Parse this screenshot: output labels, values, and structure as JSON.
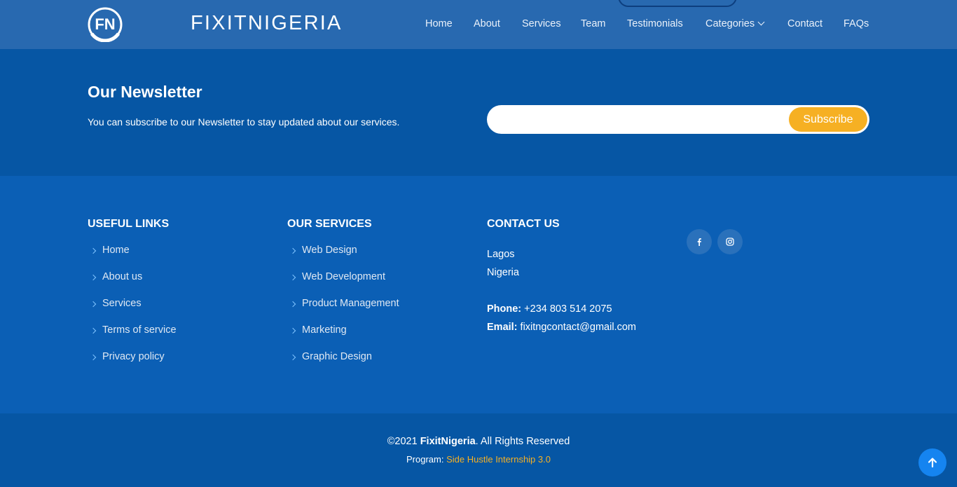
{
  "header": {
    "brand": "FIXITNIGERIA",
    "logo_text": "FN",
    "nav": [
      {
        "label": "Home"
      },
      {
        "label": "About"
      },
      {
        "label": "Services"
      },
      {
        "label": "Team"
      },
      {
        "label": "Testimonials"
      },
      {
        "label": "Categories",
        "icon": "chevron-down-icon"
      },
      {
        "label": "Contact"
      },
      {
        "label": "FAQs"
      }
    ]
  },
  "newsletter": {
    "title": "Our Newsletter",
    "text": "You can subscribe to our Newsletter to stay updated about our services.",
    "input_value": "",
    "button_label": "Subscribe"
  },
  "footer": {
    "useful_links": {
      "title": "USEFUL LINKS",
      "items": [
        "Home",
        "About us",
        "Services",
        "Terms of service",
        "Privacy policy"
      ]
    },
    "services": {
      "title": "OUR SERVICES",
      "items": [
        "Web Design",
        "Web Development",
        "Product Management",
        "Marketing",
        "Graphic Design"
      ]
    },
    "contact": {
      "title": "CONTACT US",
      "city": "Lagos",
      "country": "Nigeria",
      "phone_label": "Phone:",
      "phone": "+234 803 514 2075",
      "email_label": "Email:",
      "email": "fixitngcontact@gmail.com"
    },
    "social": [
      {
        "icon": "facebook-icon"
      },
      {
        "icon": "instagram-icon"
      }
    ]
  },
  "bottom": {
    "copyright_prefix": "©2021",
    "copyright_brand": "FixitNigeria",
    "copyright_suffix": ". All Rights Reserved",
    "program_label": "Program:",
    "program_value": "Side Hustle Internship 3.0"
  },
  "colors": {
    "header_bg": "#2869b0",
    "newsletter_bg": "#0656a4",
    "footer_bg": "#0b5fb5",
    "accent_orange": "#f6b023",
    "back_to_top": "#1584f0"
  }
}
